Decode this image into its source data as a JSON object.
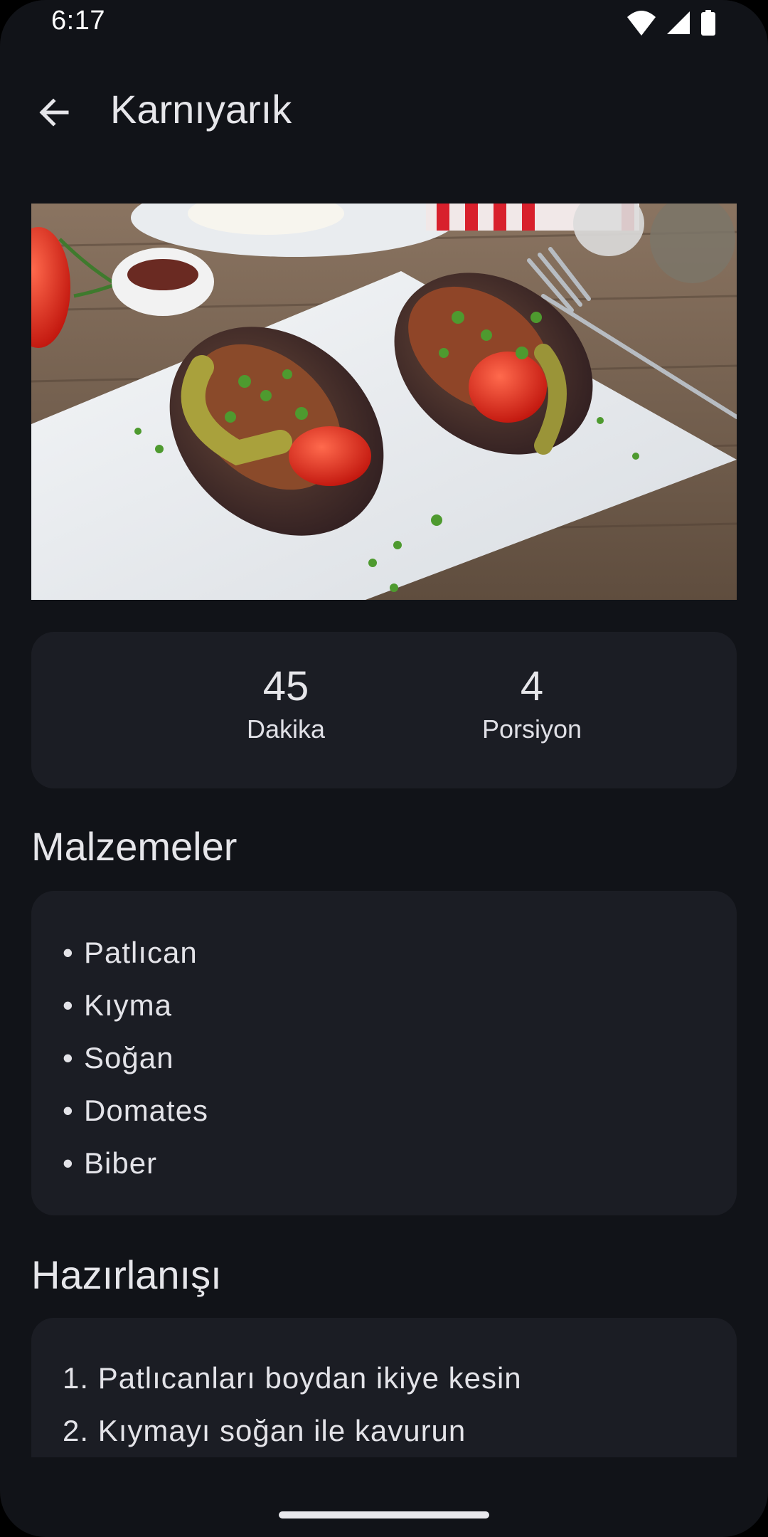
{
  "status_bar": {
    "time": "6:17",
    "icons": [
      "wifi-icon",
      "signal-icon",
      "battery-icon"
    ]
  },
  "app_bar": {
    "back_icon": "arrow-back-icon",
    "title": "Karnıyarık"
  },
  "hero_image": {
    "subject": "karniyarik-dish-photo"
  },
  "stats": {
    "minutes_value": "45",
    "minutes_label": "Dakika",
    "portion_value": "4",
    "portion_label": "Porsiyon"
  },
  "ingredients": {
    "title": "Malzemeler",
    "bullet": "•",
    "items": [
      "Patlıcan",
      "Kıyma",
      "Soğan",
      "Domates",
      "Biber"
    ]
  },
  "steps": {
    "title": "Hazırlanışı",
    "items": [
      "1. Patlıcanları boydan ikiye kesin",
      "2. Kıymayı soğan ile kavurun"
    ]
  },
  "colors": {
    "background": "#111318",
    "card": "#1b1d24",
    "text": "#e3e3e8"
  }
}
